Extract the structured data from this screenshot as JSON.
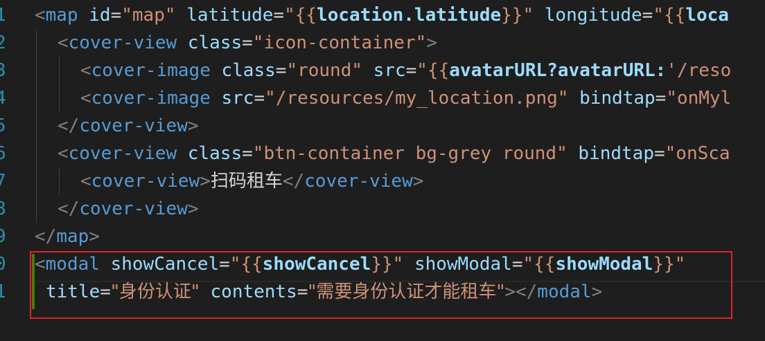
{
  "editor": {
    "line_numbers": [
      "1",
      "2",
      "3",
      "4",
      "5",
      "6",
      "7",
      "8",
      "9",
      "0",
      "1"
    ],
    "lines": [
      {
        "indent": 0,
        "tokens": [
          {
            "c": "p",
            "v": "<"
          },
          {
            "c": "t",
            "v": "map"
          },
          {
            "c": "pl",
            "v": " "
          },
          {
            "c": "a",
            "v": "id"
          },
          {
            "c": "pl",
            "v": "="
          },
          {
            "c": "s",
            "v": "\"map\""
          },
          {
            "c": "pl",
            "v": " "
          },
          {
            "c": "a",
            "v": "latitude"
          },
          {
            "c": "pl",
            "v": "="
          },
          {
            "c": "s",
            "v": "\"{{"
          },
          {
            "c": "b",
            "v": "location.latitude"
          },
          {
            "c": "s",
            "v": "}}\""
          },
          {
            "c": "pl",
            "v": " "
          },
          {
            "c": "a",
            "v": "longitude"
          },
          {
            "c": "pl",
            "v": "="
          },
          {
            "c": "s",
            "v": "\"{{"
          },
          {
            "c": "b",
            "v": "loca"
          }
        ]
      },
      {
        "indent": 1,
        "tokens": [
          {
            "c": "p",
            "v": "<"
          },
          {
            "c": "t",
            "v": "cover-view"
          },
          {
            "c": "pl",
            "v": " "
          },
          {
            "c": "a",
            "v": "class"
          },
          {
            "c": "pl",
            "v": "="
          },
          {
            "c": "s",
            "v": "\"icon-container\""
          },
          {
            "c": "p",
            "v": ">"
          }
        ]
      },
      {
        "indent": 2,
        "tokens": [
          {
            "c": "p",
            "v": "<"
          },
          {
            "c": "t",
            "v": "cover-image"
          },
          {
            "c": "pl",
            "v": " "
          },
          {
            "c": "a",
            "v": "class"
          },
          {
            "c": "pl",
            "v": "="
          },
          {
            "c": "s",
            "v": "\"round\""
          },
          {
            "c": "pl",
            "v": " "
          },
          {
            "c": "a",
            "v": "src"
          },
          {
            "c": "pl",
            "v": "="
          },
          {
            "c": "s",
            "v": "\"{{"
          },
          {
            "c": "b",
            "v": "avatarURL?avatarURL:"
          },
          {
            "c": "s",
            "v": "'/reso"
          }
        ]
      },
      {
        "indent": 2,
        "tokens": [
          {
            "c": "p",
            "v": "<"
          },
          {
            "c": "t",
            "v": "cover-image"
          },
          {
            "c": "pl",
            "v": " "
          },
          {
            "c": "a",
            "v": "src"
          },
          {
            "c": "pl",
            "v": "="
          },
          {
            "c": "s",
            "v": "\"/resources/my_location.png\""
          },
          {
            "c": "pl",
            "v": " "
          },
          {
            "c": "a",
            "v": "bindtap"
          },
          {
            "c": "pl",
            "v": "="
          },
          {
            "c": "s",
            "v": "\"onMyl"
          }
        ]
      },
      {
        "indent": 1,
        "tokens": [
          {
            "c": "p",
            "v": "</"
          },
          {
            "c": "t",
            "v": "cover-view"
          },
          {
            "c": "p",
            "v": ">"
          }
        ]
      },
      {
        "indent": 1,
        "tokens": [
          {
            "c": "p",
            "v": "<"
          },
          {
            "c": "t",
            "v": "cover-view"
          },
          {
            "c": "pl",
            "v": " "
          },
          {
            "c": "a",
            "v": "class"
          },
          {
            "c": "pl",
            "v": "="
          },
          {
            "c": "s",
            "v": "\"btn-container bg-grey round\""
          },
          {
            "c": "pl",
            "v": " "
          },
          {
            "c": "a",
            "v": "bindtap"
          },
          {
            "c": "pl",
            "v": "="
          },
          {
            "c": "s",
            "v": "\"onSca"
          }
        ]
      },
      {
        "indent": 2,
        "tokens": [
          {
            "c": "p",
            "v": "<"
          },
          {
            "c": "t",
            "v": "cover-view"
          },
          {
            "c": "p",
            "v": ">"
          },
          {
            "c": "pl cjk",
            "v": "扫码租车"
          },
          {
            "c": "p",
            "v": "</"
          },
          {
            "c": "t",
            "v": "cover-view"
          },
          {
            "c": "p",
            "v": ">"
          }
        ]
      },
      {
        "indent": 1,
        "tokens": [
          {
            "c": "p",
            "v": "</"
          },
          {
            "c": "t",
            "v": "cover-view"
          },
          {
            "c": "p",
            "v": ">"
          }
        ]
      },
      {
        "indent": 0,
        "tokens": [
          {
            "c": "p",
            "v": "</"
          },
          {
            "c": "t",
            "v": "map"
          },
          {
            "c": "p",
            "v": ">"
          }
        ]
      },
      {
        "indent": 0,
        "tokens": [
          {
            "c": "p",
            "v": "<"
          },
          {
            "c": "t",
            "v": "modal"
          },
          {
            "c": "pl",
            "v": " "
          },
          {
            "c": "a",
            "v": "showCancel"
          },
          {
            "c": "pl",
            "v": "="
          },
          {
            "c": "s",
            "v": "\"{{"
          },
          {
            "c": "b",
            "v": "showCancel"
          },
          {
            "c": "s",
            "v": "}}\""
          },
          {
            "c": "pl",
            "v": " "
          },
          {
            "c": "a",
            "v": "showModal"
          },
          {
            "c": "pl",
            "v": "="
          },
          {
            "c": "s",
            "v": "\"{{"
          },
          {
            "c": "b",
            "v": "showModal"
          },
          {
            "c": "s",
            "v": "}}\""
          }
        ]
      },
      {
        "indent": 0,
        "wrap": true,
        "tokens": [
          {
            "c": "a",
            "v": "title"
          },
          {
            "c": "pl",
            "v": "="
          },
          {
            "c": "s cjk",
            "v": "\"身份认证\""
          },
          {
            "c": "pl",
            "v": " "
          },
          {
            "c": "a",
            "v": "contents"
          },
          {
            "c": "pl",
            "v": "="
          },
          {
            "c": "s cjk",
            "v": "\"需要身份认证才能租车\""
          },
          {
            "c": "p",
            "v": "></"
          },
          {
            "c": "t",
            "v": "modal"
          },
          {
            "c": "p",
            "v": ">"
          }
        ]
      }
    ]
  },
  "colors": {
    "background": "#1e1e1e",
    "line_number": "#2b91af",
    "tag": "#569cd6",
    "attribute": "#9cdcfe",
    "string": "#ce9178",
    "punctuation": "#808080",
    "highlight_box": "#e0242c",
    "modified_bar": "#487e02"
  }
}
